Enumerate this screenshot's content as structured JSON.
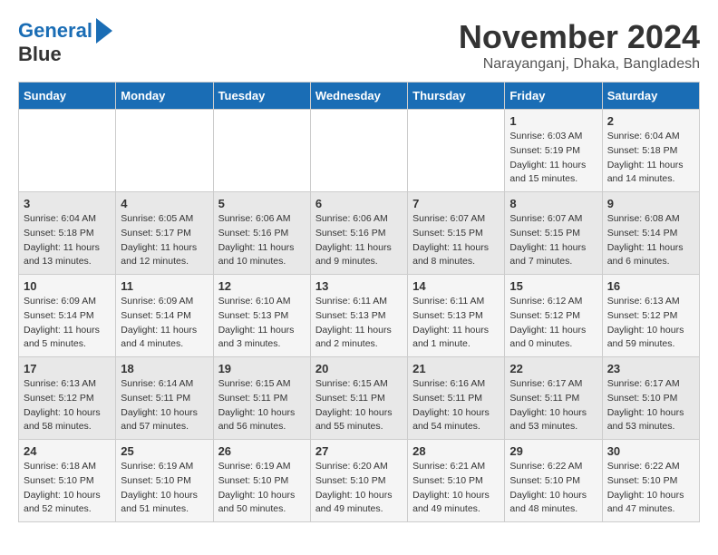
{
  "logo": {
    "text1": "General",
    "text2": "Blue"
  },
  "title": "November 2024",
  "location": "Narayanganj, Dhaka, Bangladesh",
  "weekdays": [
    "Sunday",
    "Monday",
    "Tuesday",
    "Wednesday",
    "Thursday",
    "Friday",
    "Saturday"
  ],
  "weeks": [
    [
      {
        "day": "",
        "info": ""
      },
      {
        "day": "",
        "info": ""
      },
      {
        "day": "",
        "info": ""
      },
      {
        "day": "",
        "info": ""
      },
      {
        "day": "",
        "info": ""
      },
      {
        "day": "1",
        "info": "Sunrise: 6:03 AM\nSunset: 5:19 PM\nDaylight: 11 hours\nand 15 minutes."
      },
      {
        "day": "2",
        "info": "Sunrise: 6:04 AM\nSunset: 5:18 PM\nDaylight: 11 hours\nand 14 minutes."
      }
    ],
    [
      {
        "day": "3",
        "info": "Sunrise: 6:04 AM\nSunset: 5:18 PM\nDaylight: 11 hours\nand 13 minutes."
      },
      {
        "day": "4",
        "info": "Sunrise: 6:05 AM\nSunset: 5:17 PM\nDaylight: 11 hours\nand 12 minutes."
      },
      {
        "day": "5",
        "info": "Sunrise: 6:06 AM\nSunset: 5:16 PM\nDaylight: 11 hours\nand 10 minutes."
      },
      {
        "day": "6",
        "info": "Sunrise: 6:06 AM\nSunset: 5:16 PM\nDaylight: 11 hours\nand 9 minutes."
      },
      {
        "day": "7",
        "info": "Sunrise: 6:07 AM\nSunset: 5:15 PM\nDaylight: 11 hours\nand 8 minutes."
      },
      {
        "day": "8",
        "info": "Sunrise: 6:07 AM\nSunset: 5:15 PM\nDaylight: 11 hours\nand 7 minutes."
      },
      {
        "day": "9",
        "info": "Sunrise: 6:08 AM\nSunset: 5:14 PM\nDaylight: 11 hours\nand 6 minutes."
      }
    ],
    [
      {
        "day": "10",
        "info": "Sunrise: 6:09 AM\nSunset: 5:14 PM\nDaylight: 11 hours\nand 5 minutes."
      },
      {
        "day": "11",
        "info": "Sunrise: 6:09 AM\nSunset: 5:14 PM\nDaylight: 11 hours\nand 4 minutes."
      },
      {
        "day": "12",
        "info": "Sunrise: 6:10 AM\nSunset: 5:13 PM\nDaylight: 11 hours\nand 3 minutes."
      },
      {
        "day": "13",
        "info": "Sunrise: 6:11 AM\nSunset: 5:13 PM\nDaylight: 11 hours\nand 2 minutes."
      },
      {
        "day": "14",
        "info": "Sunrise: 6:11 AM\nSunset: 5:13 PM\nDaylight: 11 hours\nand 1 minute."
      },
      {
        "day": "15",
        "info": "Sunrise: 6:12 AM\nSunset: 5:12 PM\nDaylight: 11 hours\nand 0 minutes."
      },
      {
        "day": "16",
        "info": "Sunrise: 6:13 AM\nSunset: 5:12 PM\nDaylight: 10 hours\nand 59 minutes."
      }
    ],
    [
      {
        "day": "17",
        "info": "Sunrise: 6:13 AM\nSunset: 5:12 PM\nDaylight: 10 hours\nand 58 minutes."
      },
      {
        "day": "18",
        "info": "Sunrise: 6:14 AM\nSunset: 5:11 PM\nDaylight: 10 hours\nand 57 minutes."
      },
      {
        "day": "19",
        "info": "Sunrise: 6:15 AM\nSunset: 5:11 PM\nDaylight: 10 hours\nand 56 minutes."
      },
      {
        "day": "20",
        "info": "Sunrise: 6:15 AM\nSunset: 5:11 PM\nDaylight: 10 hours\nand 55 minutes."
      },
      {
        "day": "21",
        "info": "Sunrise: 6:16 AM\nSunset: 5:11 PM\nDaylight: 10 hours\nand 54 minutes."
      },
      {
        "day": "22",
        "info": "Sunrise: 6:17 AM\nSunset: 5:11 PM\nDaylight: 10 hours\nand 53 minutes."
      },
      {
        "day": "23",
        "info": "Sunrise: 6:17 AM\nSunset: 5:10 PM\nDaylight: 10 hours\nand 53 minutes."
      }
    ],
    [
      {
        "day": "24",
        "info": "Sunrise: 6:18 AM\nSunset: 5:10 PM\nDaylight: 10 hours\nand 52 minutes."
      },
      {
        "day": "25",
        "info": "Sunrise: 6:19 AM\nSunset: 5:10 PM\nDaylight: 10 hours\nand 51 minutes."
      },
      {
        "day": "26",
        "info": "Sunrise: 6:19 AM\nSunset: 5:10 PM\nDaylight: 10 hours\nand 50 minutes."
      },
      {
        "day": "27",
        "info": "Sunrise: 6:20 AM\nSunset: 5:10 PM\nDaylight: 10 hours\nand 49 minutes."
      },
      {
        "day": "28",
        "info": "Sunrise: 6:21 AM\nSunset: 5:10 PM\nDaylight: 10 hours\nand 49 minutes."
      },
      {
        "day": "29",
        "info": "Sunrise: 6:22 AM\nSunset: 5:10 PM\nDaylight: 10 hours\nand 48 minutes."
      },
      {
        "day": "30",
        "info": "Sunrise: 6:22 AM\nSunset: 5:10 PM\nDaylight: 10 hours\nand 47 minutes."
      }
    ]
  ]
}
